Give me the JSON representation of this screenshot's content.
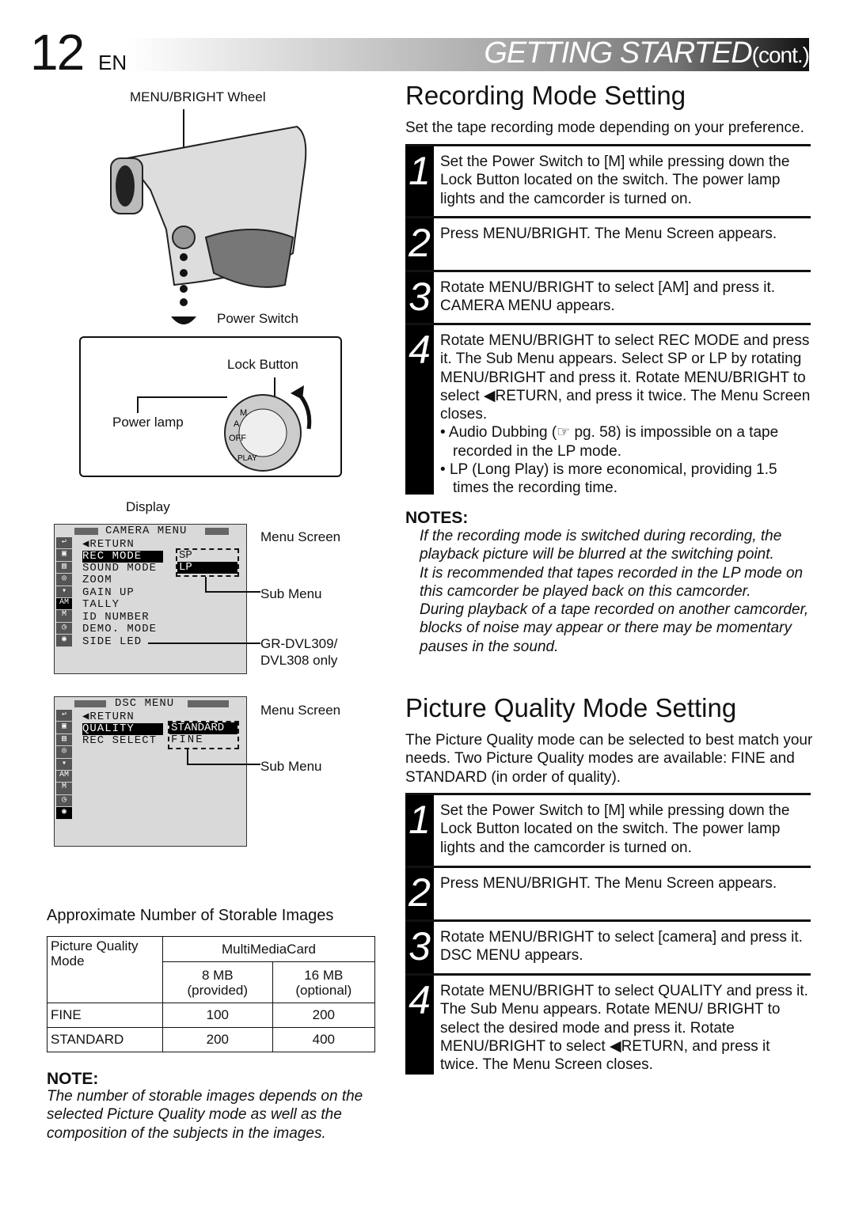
{
  "header": {
    "page_number": "12",
    "lang": "EN",
    "section": "GETTING STARTED",
    "cont": "(cont.)"
  },
  "figure": {
    "wheel_label": "MENU/BRIGHT Wheel",
    "power_switch": "Power Switch",
    "lock_button": "Lock Button",
    "power_lamp": "Power lamp",
    "display": "Display",
    "dial_labels": [
      "OFF",
      "A",
      "M",
      "PLAY"
    ]
  },
  "camera_menu": {
    "title": "CAMERA MENU",
    "items": [
      "◀RETURN",
      "REC MODE",
      "SOUND MODE",
      "ZOOM",
      "GAIN UP",
      "TALLY",
      "ID NUMBER",
      "DEMO. MODE",
      "SIDE LED"
    ],
    "sub": [
      "SP",
      "LP"
    ],
    "menu_screen": "Menu Screen",
    "sub_menu": "Sub Menu",
    "model_note": "GR-DVL309/ DVL308 only"
  },
  "dsc_menu": {
    "title": "DSC MENU",
    "items": [
      "◀RETURN",
      "QUALITY",
      "REC SELECT"
    ],
    "sub": [
      "STANDARD",
      "FINE"
    ],
    "menu_screen": "Menu Screen",
    "sub_menu": "Sub Menu"
  },
  "storable": {
    "title": "Approximate Number of Storable Images",
    "col0": "Picture Quality Mode",
    "group": "MultiMediaCard",
    "cols": [
      {
        "size": "8 MB",
        "note": "(provided)"
      },
      {
        "size": "16 MB",
        "note": "(optional)"
      }
    ],
    "rows": [
      {
        "mode": "FINE",
        "values": [
          "100",
          "200"
        ]
      },
      {
        "mode": "STANDARD",
        "values": [
          "200",
          "400"
        ]
      }
    ]
  },
  "note": {
    "heading": "NOTE:",
    "text": "The number of storable images depends on the selected Picture Quality mode as well as the composition of the subjects in the images."
  },
  "recording": {
    "title": "Recording Mode Setting",
    "intro": "Set the tape recording mode depending on your preference.",
    "steps": [
      {
        "n": "1",
        "text": "Set the Power Switch to [M] while pressing down the Lock Button located on the switch. The power lamp lights and the camcorder is turned on."
      },
      {
        "n": "2",
        "text": "Press MENU/BRIGHT. The Menu Screen appears."
      },
      {
        "n": "3",
        "text": "Rotate MENU/BRIGHT to select [AM] and press it. CAMERA MENU appears."
      },
      {
        "n": "4",
        "text": "Rotate MENU/BRIGHT to select REC MODE and press it. The Sub Menu appears. Select SP or LP by rotating MENU/BRIGHT and press it. Rotate MENU/BRIGHT to select ◀RETURN, and press it twice. The Menu Screen closes.",
        "bullets": [
          "Audio Dubbing (☞ pg. 58) is impossible on a tape recorded in the LP mode.",
          "LP (Long Play) is more economical, providing 1.5 times the recording time."
        ]
      }
    ]
  },
  "notes": {
    "heading": "NOTES:",
    "items": [
      "If the recording mode is switched during recording, the playback picture will be blurred at the switching point.",
      "It is recommended that tapes recorded in the LP mode on this camcorder be played back on this camcorder.",
      "During playback of a tape recorded on another camcorder, blocks of noise may appear or there may be momentary pauses in the sound."
    ]
  },
  "quality": {
    "title": "Picture Quality Mode Setting",
    "intro": "The Picture Quality mode can be selected to best match your needs. Two Picture Quality modes are available: FINE and STANDARD (in order of quality).",
    "steps": [
      {
        "n": "1",
        "text": "Set the Power Switch to [M] while pressing down the Lock Button located on the switch. The power lamp lights and the camcorder is turned on."
      },
      {
        "n": "2",
        "text": "Press MENU/BRIGHT. The Menu Screen appears."
      },
      {
        "n": "3",
        "text": "Rotate MENU/BRIGHT to select [camera] and press it. DSC MENU appears."
      },
      {
        "n": "4",
        "text": "Rotate MENU/BRIGHT to select QUALITY and press it. The Sub Menu appears. Rotate MENU/ BRIGHT to select the desired mode and press it. Rotate MENU/BRIGHT to select ◀RETURN, and press it twice. The Menu Screen closes."
      }
    ]
  }
}
